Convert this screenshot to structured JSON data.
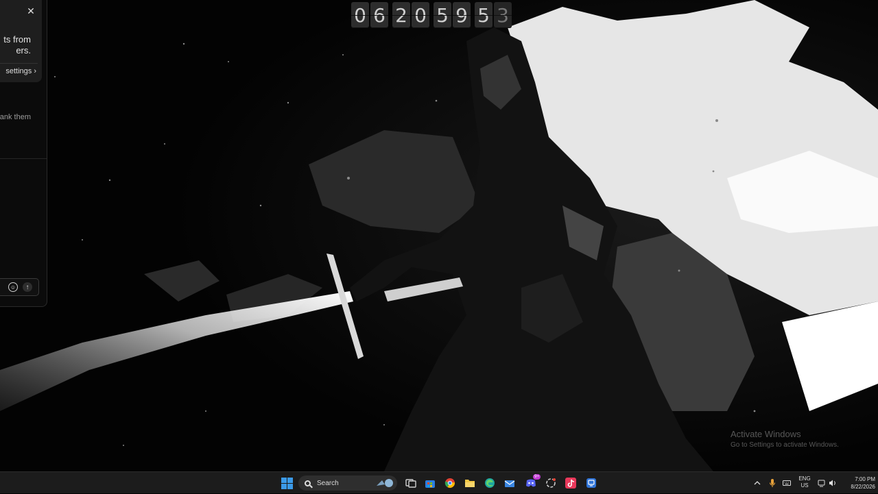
{
  "clock_widget": {
    "digits": [
      "0",
      "6",
      "2",
      "0",
      "5",
      "9",
      "5",
      "3"
    ]
  },
  "chat_panel": {
    "notice": {
      "close_glyph": "✕",
      "text_line1": "ts from",
      "text_line2": "ers.",
      "settings_link": "settings",
      "settings_chevron": "›"
    },
    "body_text": "ank them",
    "input": {
      "emoji_glyph": "☺",
      "send_glyph": "↑"
    }
  },
  "watermark": {
    "title": "Activate Windows",
    "subtitle": "Go to Settings to activate Windows."
  },
  "taskbar": {
    "search_label": "Search",
    "apps": [
      {
        "name": "task-view-icon",
        "color": "#d0d0d0"
      },
      {
        "name": "microsoft-store-icon",
        "color": "#2b7de0"
      },
      {
        "name": "chrome-icon",
        "color": "#e34133"
      },
      {
        "name": "file-explorer-icon",
        "color": "#f2c744"
      },
      {
        "name": "edge-icon",
        "color": "#1fa6a0"
      },
      {
        "name": "mail-icon",
        "color": "#3a86e0"
      },
      {
        "name": "discord-icon",
        "color": "#5865f2"
      },
      {
        "name": "chatgpt-icon",
        "color": "#cfcfcf"
      },
      {
        "name": "tiktok-icon",
        "color": "#e8385a"
      },
      {
        "name": "remote-desktop-icon",
        "color": "#2f74d8"
      }
    ],
    "discord_badge": "9+",
    "tray": {
      "lang_line1": "ENG",
      "lang_line2": "US",
      "time": "7:00 PM",
      "date": "8/22/2026"
    }
  }
}
